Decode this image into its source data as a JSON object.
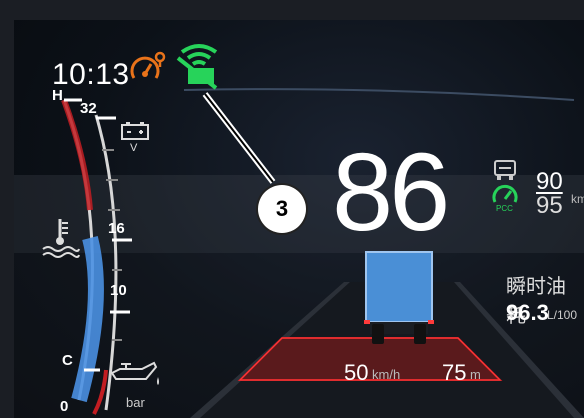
{
  "clock": {
    "time": "10:13"
  },
  "indicators": {
    "callout_number": "3",
    "battery": {
      "label": "V"
    },
    "cruise": {
      "label": "PCC"
    }
  },
  "speedometer": {
    "current_speed": "86",
    "speed_limit_top": "90",
    "speed_limit_bottom": "95",
    "unit": "km/"
  },
  "temperature_gauge": {
    "high_label": "H",
    "low_label": "C"
  },
  "fuel_gauge": {
    "scale_top": "32",
    "scale_mid": "16",
    "scale_low": "10",
    "scale_zero": "0"
  },
  "oil": {
    "unit": "bar"
  },
  "consumption": {
    "label": "瞬时油耗",
    "value": "96.3",
    "unit": "L/100"
  },
  "acc": {
    "set_speed": "50",
    "set_speed_unit": "km/h",
    "distance": "75",
    "distance_unit": "m"
  },
  "colors": {
    "warning_orange": "#e9731a",
    "connected_green": "#27d35a",
    "gauge_blue": "#4a90e2",
    "lane_red": "#c21d22"
  }
}
